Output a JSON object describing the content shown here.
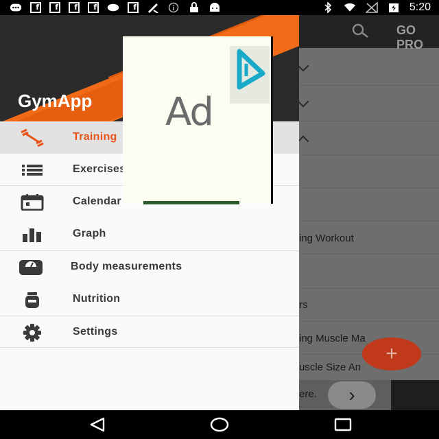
{
  "status_bar": {
    "time": "5:20",
    "icons": [
      "chat-icon",
      "facebook-icon",
      "facebook-icon",
      "facebook-icon",
      "facebook-icon",
      "circle-icon",
      "facebook-icon",
      "ruler-icon",
      "info-icon",
      "lock-icon",
      "android-icon",
      "bluetooth-icon",
      "wifi-icon",
      "no-signal-icon",
      "battery-icon"
    ]
  },
  "app": {
    "toolbar_action": "GO PRO",
    "rows": [
      {
        "text": ""
      },
      {
        "text": ""
      },
      {
        "text": ""
      },
      {
        "text": ""
      },
      {
        "text": ""
      },
      {
        "text": "ing Workout"
      },
      {
        "text": ""
      },
      {
        "text": "rs"
      },
      {
        "text": "ing Muscle Ma"
      },
      {
        "text": "uscle Size An"
      }
    ],
    "fab_label": "+",
    "ad_strip_text": "ere.",
    "ad_strip_button": "›"
  },
  "drawer": {
    "app_name": "GymApp",
    "items": [
      {
        "label": "Training",
        "icon": "dumbbell-icon",
        "active": true
      },
      {
        "label": "Exercises",
        "icon": "list-icon",
        "active": false
      },
      {
        "label": "Calendar",
        "icon": "calendar-icon",
        "active": false
      },
      {
        "label": "Graph",
        "icon": "bar-chart-icon",
        "active": false
      },
      {
        "label": "Body measurements",
        "icon": "scale-icon",
        "active": false
      },
      {
        "label": "Nutrition",
        "icon": "jar-icon",
        "active": false
      },
      {
        "label": "Settings",
        "icon": "gear-icon",
        "active": false
      }
    ]
  },
  "ad": {
    "text": "Ad"
  },
  "colors": {
    "accent": "#e8541a",
    "drawer_bg": "#fafafa",
    "toolbar_bg": "#232323"
  }
}
